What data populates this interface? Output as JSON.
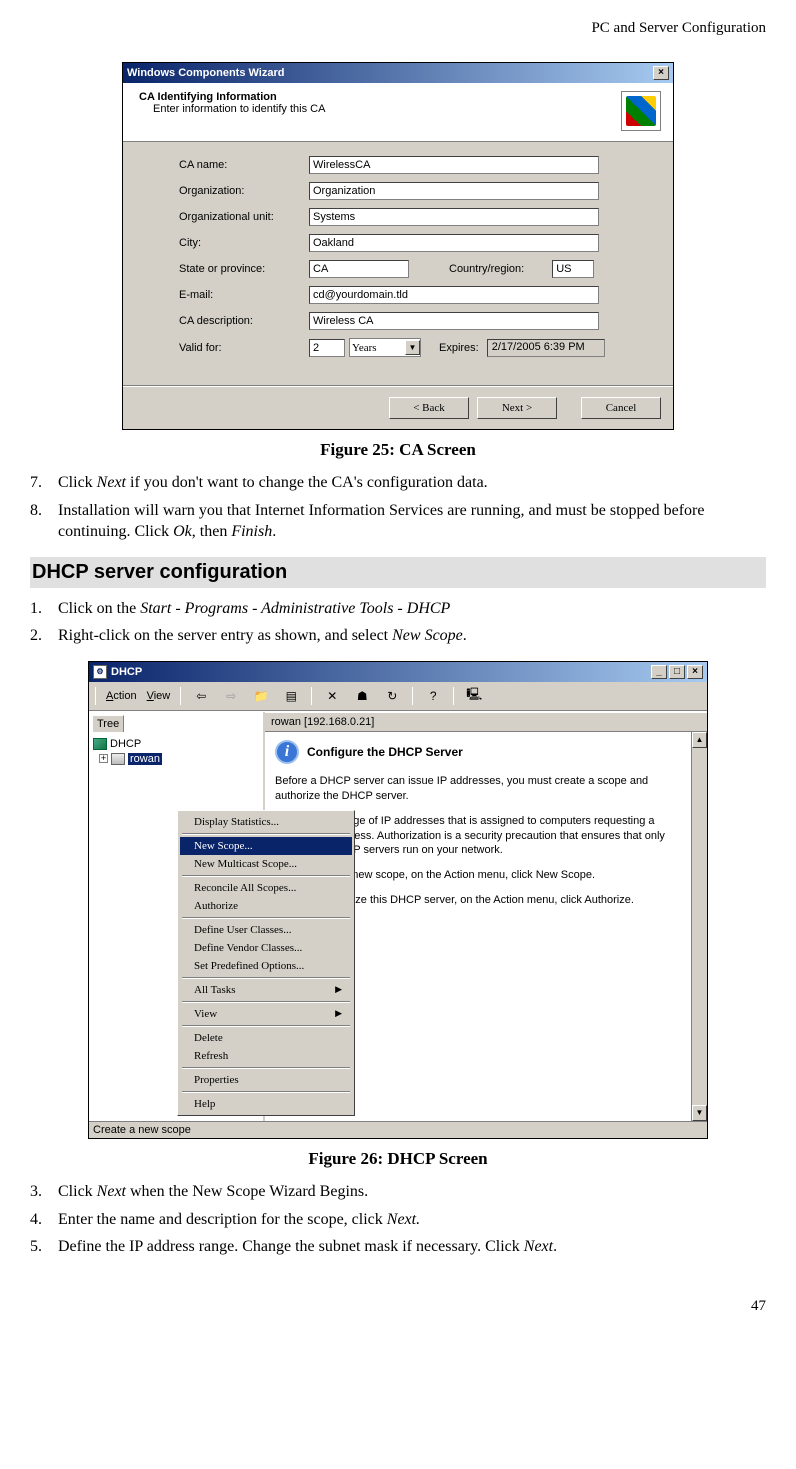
{
  "page_header": "PC and Server Configuration",
  "page_number": "47",
  "figure25": {
    "caption": "Figure 25: CA Screen",
    "window_title": "Windows Components Wizard",
    "header_title": "CA Identifying Information",
    "header_sub": "Enter information to identify this CA",
    "labels": {
      "ca_name": "CA name:",
      "organization": "Organization:",
      "org_unit": "Organizational unit:",
      "city": "City:",
      "state": "State or province:",
      "country": "Country/region:",
      "email": "E-mail:",
      "ca_desc": "CA description:",
      "valid_for": "Valid for:",
      "expires": "Expires:"
    },
    "values": {
      "ca_name": "WirelessCA",
      "organization": "Organization",
      "org_unit": "Systems",
      "city": "Oakland",
      "state": "CA",
      "country": "US",
      "email": "cd@yourdomain.tld",
      "ca_desc": "Wireless CA",
      "valid_num": "2",
      "valid_unit": "Years",
      "expires": "2/17/2005 6:39 PM"
    },
    "buttons": {
      "back": "< Back",
      "next": "Next >",
      "cancel": "Cancel"
    }
  },
  "steps_a": {
    "7": "Click Next if you don't want to change the CA's configuration data.",
    "8": "Installation will warn you that Internet Information Services are running, and must be stopped before continuing. Click Ok, then Finish."
  },
  "section_heading": "DHCP server configuration",
  "steps_b": {
    "1": "Click on the Start - Programs - Administrative Tools - DHCP",
    "2": "Right-click on the server entry as shown, and select New Scope."
  },
  "figure26": {
    "caption": "Figure 26: DHCP Screen",
    "window_title": "DHCP",
    "menu": {
      "action": "Action",
      "view": "View"
    },
    "tree_tab": "Tree",
    "tree_root": "DHCP",
    "tree_server": "rowan",
    "right_header": "rowan [192.168.0.21]",
    "config_title": "Configure the DHCP Server",
    "para1": "Before a DHCP server can issue IP addresses, you must create a scope and authorize the DHCP server.",
    "para2": "A scope is a range of IP addresses that is assigned to computers requesting a dynamic IP address. Authorization is a security precaution that ensures that only authorized DHCP servers run on your network.",
    "para3": "To add a new scope, on the Action menu, click New Scope.",
    "para4": "To authorize this DHCP server, on the Action menu, click Authorize.",
    "context_menu": {
      "display_stats": "Display Statistics...",
      "new_scope": "New Scope...",
      "new_multicast": "New Multicast Scope...",
      "reconcile": "Reconcile All Scopes...",
      "authorize": "Authorize",
      "def_user": "Define User Classes...",
      "def_vendor": "Define Vendor Classes...",
      "set_predef": "Set Predefined Options...",
      "all_tasks": "All Tasks",
      "view": "View",
      "delete": "Delete",
      "refresh": "Refresh",
      "properties": "Properties",
      "help": "Help"
    },
    "status_bar": "Create a new scope"
  },
  "steps_c": {
    "3": "Click Next when the New Scope Wizard Begins.",
    "4": "Enter the name and description for the scope, click Next.",
    "5": "Define the IP address range. Change the subnet mask if necessary. Click Next."
  }
}
